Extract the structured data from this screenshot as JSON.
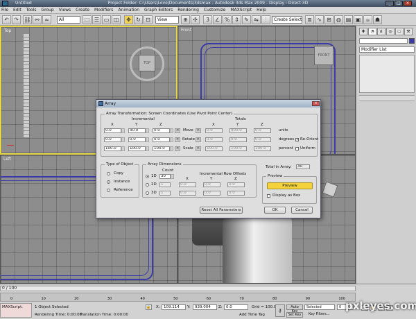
{
  "titlebar": {
    "app": "Untitled",
    "title": "Project Folder: C:\\Users\\Love\\Documents\\3dsmax    - Autodesk 3ds Max  2009     - Display : Direct 3D"
  },
  "menu": [
    "File",
    "Edit",
    "Tools",
    "Group",
    "Views",
    "Create",
    "Modifiers",
    "Animation",
    "Graph Editors",
    "Rendering",
    "Customize",
    "MAXScript",
    "Help"
  ],
  "toolbar": {
    "filter": "All",
    "view": "View",
    "selection_set": "Create Selection Set"
  },
  "viewports": {
    "top": "Top",
    "front": "Front",
    "left": "Left",
    "front_cube": "FRONT",
    "top_cube": "TOP"
  },
  "cmdpanel": {
    "modifier_list": "Modifier List"
  },
  "dialog": {
    "title": "Array",
    "transform_group": "Array Transformation: Screen Coordinates (Use Pivot Point Center)",
    "incremental": "Incremental",
    "totals": "Totals",
    "x": "X",
    "y": "Y",
    "z": "Z",
    "move": {
      "label": "Move",
      "inc": [
        "0.0",
        "30.0",
        "0.0"
      ],
      "tot": [
        "0.0",
        "900.0",
        "0.0"
      ],
      "unit": "units"
    },
    "rotate": {
      "label": "Rotate",
      "inc": [
        "0.0",
        "0.0",
        "0.0"
      ],
      "tot": [
        "0.0",
        "0.0",
        "0.0"
      ],
      "unit": "degrees",
      "option": "Re-Orient"
    },
    "scale": {
      "label": "Scale",
      "inc": [
        "100.0",
        "100.0",
        "100.0"
      ],
      "tot": [
        "100.0",
        "100.0",
        "100.0"
      ],
      "unit": "percent",
      "option": "Uniform"
    },
    "object_type": {
      "label": "Type of Object",
      "options": [
        "Copy",
        "Instance",
        "Reference"
      ]
    },
    "dims": {
      "label": "Array Dimensions",
      "count": "Count",
      "row_offsets": "Incremental Row Offsets",
      "d1": "1D",
      "d2": "2D",
      "d3": "3D",
      "count1": "30",
      "count2": "1",
      "count3": "1",
      "vals": [
        "0.0",
        "0.0",
        "0.0"
      ]
    },
    "total_label": "Total in Array:",
    "total": "30",
    "preview_group": "Preview",
    "preview_btn": "Preview",
    "display_as_box": "Display as Box",
    "reset": "Reset All Parameters",
    "ok": "OK",
    "cancel": "Cancel"
  },
  "bottom": {
    "time": "0 / 100",
    "ticks": [
      "0",
      "10",
      "20",
      "30",
      "40",
      "50",
      "60",
      "70",
      "80",
      "90",
      "100"
    ],
    "maxscript": "MAXScript.",
    "status": "1 Object Selected",
    "prompt": "Rendering Time: 0:00:00",
    "trans": "Translation Time: 0:00:00",
    "x": "109.114",
    "y": "939.004",
    "z": "0.0",
    "grid": "Grid = 100.0",
    "autokey": "Auto Key",
    "selected": "Selected",
    "setkey": "Set Key",
    "keyfilters": "Key Filters...",
    "addtag": "Add Time Tag",
    "frame": "0"
  },
  "watermark": "pxleyes.com"
}
